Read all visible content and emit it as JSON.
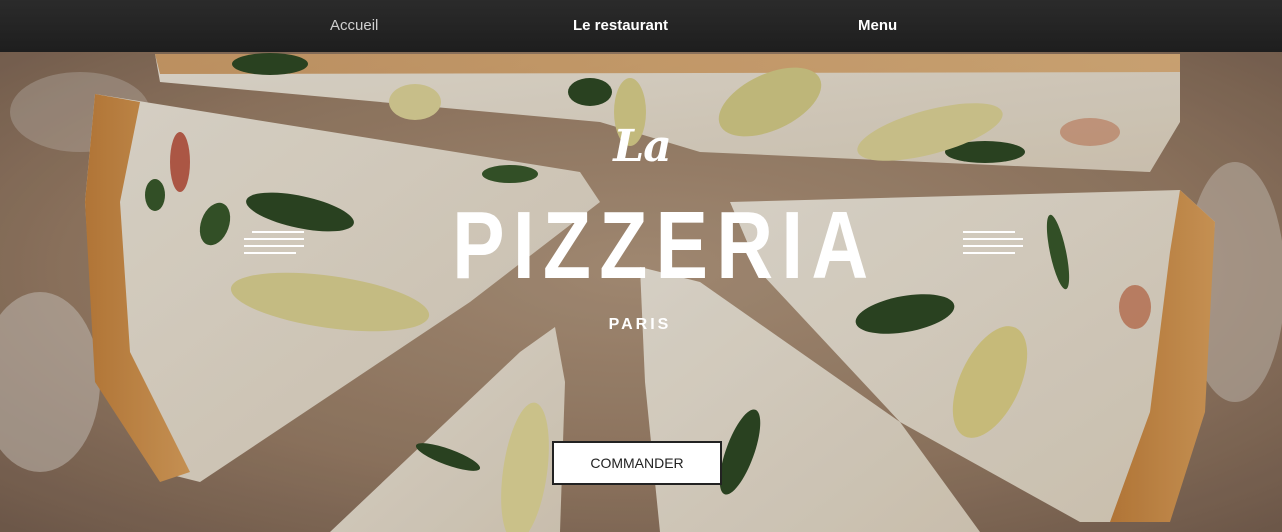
{
  "nav": {
    "items": [
      {
        "label": "Accueil"
      },
      {
        "label": "Le restaurant"
      },
      {
        "label": "Menu"
      }
    ]
  },
  "hero": {
    "script_text": "La",
    "title": "PIZZERIA",
    "subtitle": "PARIS",
    "cta_label": "COMMANDER",
    "background_image": "pizza-slices-photo"
  },
  "colors": {
    "nav_bg": "#222222",
    "text_light": "#ffffff",
    "button_bg": "#ffffff",
    "button_text": "#222222"
  }
}
